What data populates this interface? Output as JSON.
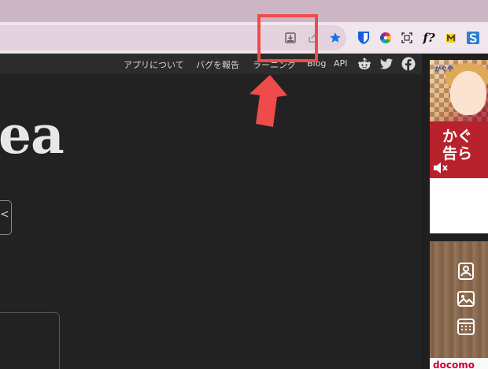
{
  "browser": {
    "toolbar_icons": [
      "install-app-icon",
      "share-icon",
      "bookmark-star-icon"
    ],
    "extensions": [
      {
        "name": "bitwarden-icon",
        "color": "#175ddc"
      },
      {
        "name": "color-wheel-icon"
      },
      {
        "name": "screenshot-frame-icon"
      },
      {
        "name": "font-detect-icon",
        "label": "f?"
      },
      {
        "name": "highlighter-icon",
        "color": "#f0d000"
      },
      {
        "name": "s-extension-icon",
        "color": "#2f7fd1"
      }
    ],
    "accent_color": "#1a73e8",
    "annotation_color": "#ef4b4b"
  },
  "site_nav": {
    "links": [
      "アプリについて",
      "バグを報告",
      "ラーニング",
      "Blog",
      "API"
    ],
    "social_icons": [
      "reddit-icon",
      "twitter-icon",
      "facebook-icon"
    ]
  },
  "main": {
    "title_fragment": "ea",
    "control_glyph": "<"
  },
  "ads": {
    "ad1": {
      "logo": "かぐや",
      "line1": "かぐ",
      "line2": "告ら"
    },
    "ad2": {
      "brand": "docomo",
      "icons": [
        "contact-icon",
        "image-icon",
        "calendar-icon"
      ]
    }
  }
}
